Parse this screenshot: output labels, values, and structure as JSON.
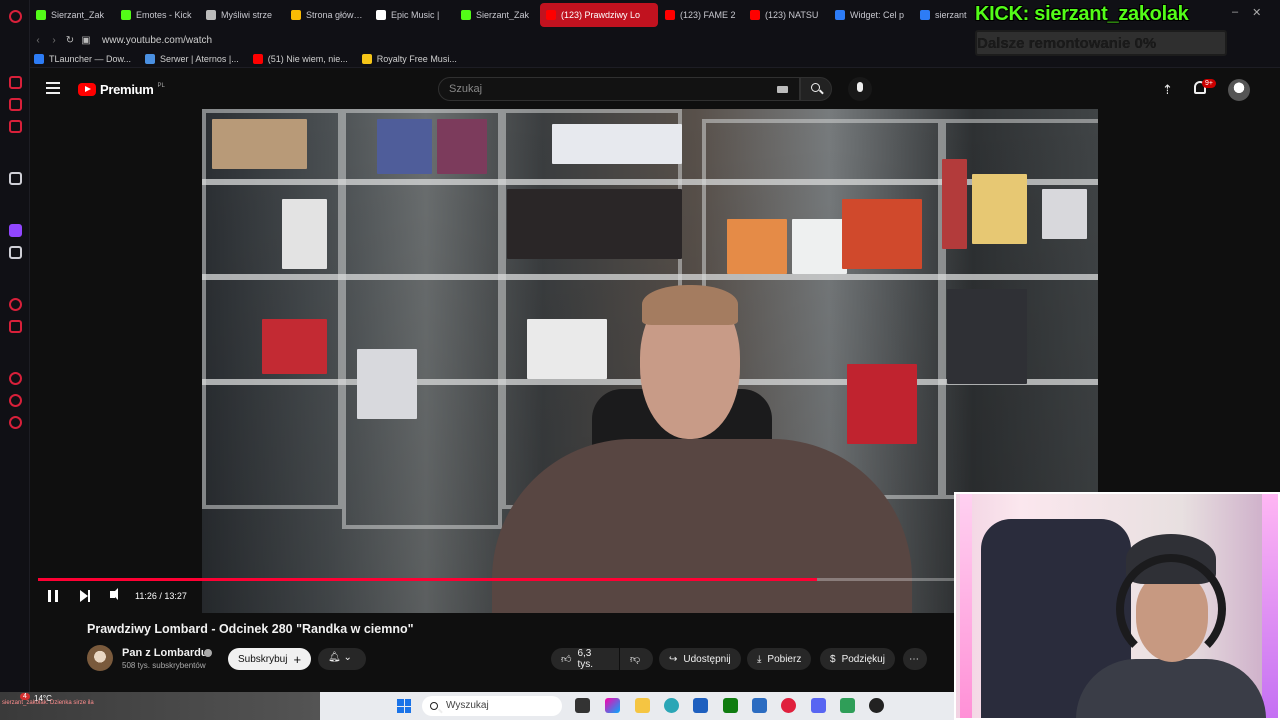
{
  "browser": {
    "tabs": [
      {
        "label": "Sierzant_Zak",
        "color": "#53fc18",
        "active": false
      },
      {
        "label": "Emotes - Kick",
        "color": "#53fc18",
        "active": false
      },
      {
        "label": "Myśliwi strze",
        "color": "#bbbbbb",
        "active": false
      },
      {
        "label": "Strona główna",
        "color": "#fbbc04",
        "active": false
      },
      {
        "label": "Epic Music |",
        "color": "#ffffff",
        "active": false
      },
      {
        "label": "Sierzant_Zak",
        "color": "#53fc18",
        "active": false
      },
      {
        "label": "(123) Prawdziwy Lo",
        "color": "#ff0000",
        "active": true
      },
      {
        "label": "(123) FAME 2",
        "color": "#ff0000",
        "active": false
      },
      {
        "label": "(123) NATSU",
        "color": "#ff0000",
        "active": false
      },
      {
        "label": "Widget: Cel p",
        "color": "#2d7cf6",
        "active": false
      },
      {
        "label": "sierzant",
        "color": "#2d7cf6",
        "active": false
      }
    ],
    "url": "www.youtube.com/watch",
    "bookmarks": [
      {
        "label": "TLauncher — Dow...",
        "color": "#2d7cf6"
      },
      {
        "label": "Serwer | Aternos |...",
        "color": "#4a90e2"
      },
      {
        "label": "(51) Nie wiem, nie...",
        "color": "#ff0000"
      },
      {
        "label": "Royalty Free Musi...",
        "color": "#f5c518"
      }
    ]
  },
  "overlay": {
    "stream_title": "KICK: sierzant_zakolak",
    "progress_label": "Dalsze remontowanie 0%",
    "progress_value": 0.0,
    "accent": "#53fc18"
  },
  "youtube": {
    "logo_text": "Premium",
    "logo_country": "PL",
    "search_placeholder": "Szukaj",
    "notification_count": "9+",
    "video": {
      "title": "Prawdziwy Lombard - Odcinek 280 \"Randka w ciemno\"",
      "current_time": "11:26",
      "duration": "13:27",
      "time_display": "11:26 / 13:27",
      "progress": 0.85
    },
    "channel": {
      "name": "Pan z Lombardu",
      "subscribers": "508 tys. subskrybentów",
      "subscribe_label": "Subskrybuj"
    },
    "actions": {
      "likes": "6,3 tys.",
      "share": "Udostępnij",
      "download": "Pobierz",
      "thanks": "Podziękuj"
    }
  },
  "taskbar": {
    "weather_temp": "14°C",
    "chat_snippet": "sierzant_zakolak: Dzienka sirze ila",
    "search_placeholder": "Wyszukaj",
    "notification_badge": "4"
  }
}
